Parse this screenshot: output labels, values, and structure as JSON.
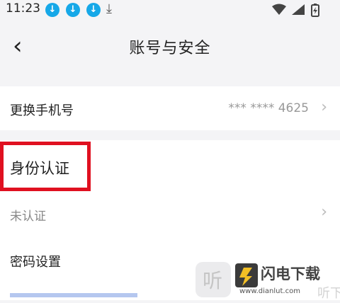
{
  "status_bar": {
    "time": "11:23"
  },
  "nav": {
    "title": "账号与安全"
  },
  "rows": {
    "phone": {
      "label": "更换手机号",
      "value": "*** **** 4625"
    },
    "identity_header": {
      "label": "身份认证"
    },
    "identity_status": {
      "label": "未认证"
    },
    "password": {
      "label": "密码设置"
    }
  },
  "watermark": {
    "brand": "闪电下载",
    "url": "www.dianlut.com",
    "ghost": "听下载"
  },
  "colors": {
    "accent_blue": "#16a8e8",
    "highlight_red": "#e01020"
  }
}
